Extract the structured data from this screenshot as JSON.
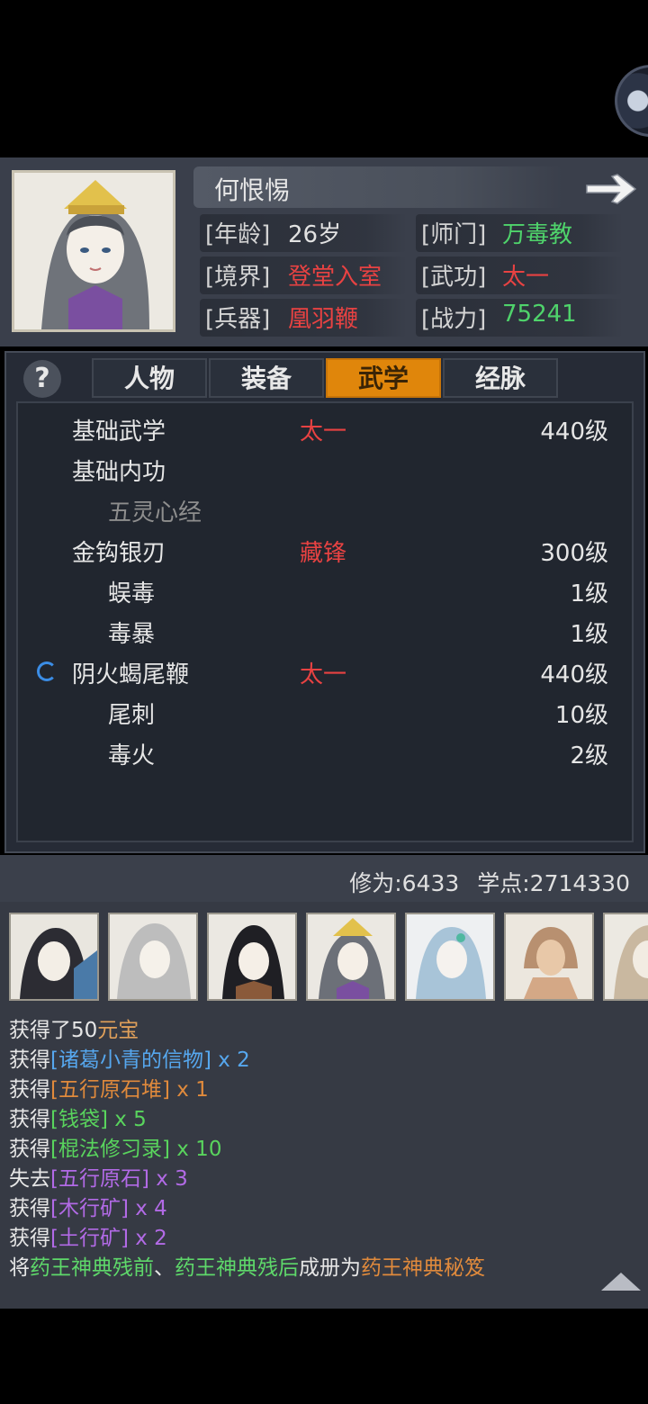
{
  "header": {
    "name": "何恨惕",
    "stats": [
      {
        "label": "[年龄]",
        "value": "26岁",
        "color": "#e2e2e2"
      },
      {
        "label": "[师门]",
        "value": "万毒教",
        "color": "#4fd36b"
      },
      {
        "label": "[境界]",
        "value": "登堂入室",
        "color": "#e84242"
      },
      {
        "label": "[武功]",
        "value": "太一",
        "color": "#e84242"
      },
      {
        "label": "[兵器]",
        "value": "凰羽鞭",
        "color": "#e84242"
      },
      {
        "label": "[战力]",
        "value": "75241",
        "color": "#4fd36b"
      }
    ]
  },
  "tabs": [
    {
      "label": "人物",
      "active": false
    },
    {
      "label": "装备",
      "active": false
    },
    {
      "label": "武学",
      "active": true
    },
    {
      "label": "经脉",
      "active": false
    }
  ],
  "skills": [
    {
      "name": "基础武学",
      "tier": "太一",
      "level": "440级",
      "sub": false,
      "dim": false
    },
    {
      "name": "基础内功",
      "tier": "",
      "level": "",
      "sub": false,
      "dim": false
    },
    {
      "name": "五灵心经",
      "tier": "",
      "level": "",
      "sub": true,
      "dim": true
    },
    {
      "name": "金钩银刃",
      "tier": "藏锋",
      "level": "300级",
      "sub": false,
      "dim": false
    },
    {
      "name": "蜈毒",
      "tier": "",
      "level": "1级",
      "sub": true,
      "dim": false
    },
    {
      "name": "毒暴",
      "tier": "",
      "level": "1级",
      "sub": true,
      "dim": false
    },
    {
      "name": "阴火蝎尾鞭",
      "tier": "太一",
      "level": "440级",
      "sub": false,
      "dim": false,
      "active": true
    },
    {
      "name": "尾刺",
      "tier": "",
      "level": "10级",
      "sub": true,
      "dim": false
    },
    {
      "name": "毒火",
      "tier": "",
      "level": "2级",
      "sub": true,
      "dim": false
    }
  ],
  "footer": {
    "cultivation": "修为:6433",
    "points": "学点:2714330"
  },
  "log": [
    [
      {
        "t": "获得了50",
        "c": ""
      },
      {
        "t": "元宝",
        "c": "c-gold"
      }
    ],
    [
      {
        "t": "获得",
        "c": ""
      },
      {
        "t": "[诸葛小青的信物]",
        "c": "c-blue"
      },
      {
        "t": " x 2",
        "c": "c-blue"
      }
    ],
    [
      {
        "t": "获得",
        "c": ""
      },
      {
        "t": "[五行原石堆]",
        "c": "c-orange"
      },
      {
        "t": " x 1",
        "c": "c-orange"
      }
    ],
    [
      {
        "t": "获得",
        "c": ""
      },
      {
        "t": "[钱袋]",
        "c": "c-green"
      },
      {
        "t": " x 5",
        "c": "c-green"
      }
    ],
    [
      {
        "t": "获得",
        "c": ""
      },
      {
        "t": "[棍法修习录]",
        "c": "c-green"
      },
      {
        "t": " x 10",
        "c": "c-green"
      }
    ],
    [
      {
        "t": "失去",
        "c": ""
      },
      {
        "t": "[五行原石]",
        "c": "c-purple"
      },
      {
        "t": " x 3",
        "c": "c-purple"
      }
    ],
    [
      {
        "t": "获得",
        "c": ""
      },
      {
        "t": "[木行矿]",
        "c": "c-purple"
      },
      {
        "t": " x 4",
        "c": "c-purple"
      }
    ],
    [
      {
        "t": "获得",
        "c": ""
      },
      {
        "t": "[土行矿]",
        "c": "c-purple"
      },
      {
        "t": " x 2",
        "c": "c-purple"
      }
    ],
    [
      {
        "t": "将",
        "c": ""
      },
      {
        "t": "药王神典残前",
        "c": "c-lgreen"
      },
      {
        "t": "、",
        "c": ""
      },
      {
        "t": "药王神典残后",
        "c": "c-lgreen"
      },
      {
        "t": "成册为",
        "c": ""
      },
      {
        "t": "药王神典秘笈",
        "c": "c-orange"
      }
    ]
  ],
  "icons": {
    "help": "?",
    "forward": "arrow-right-icon",
    "collapse": "triangle-up-icon"
  }
}
